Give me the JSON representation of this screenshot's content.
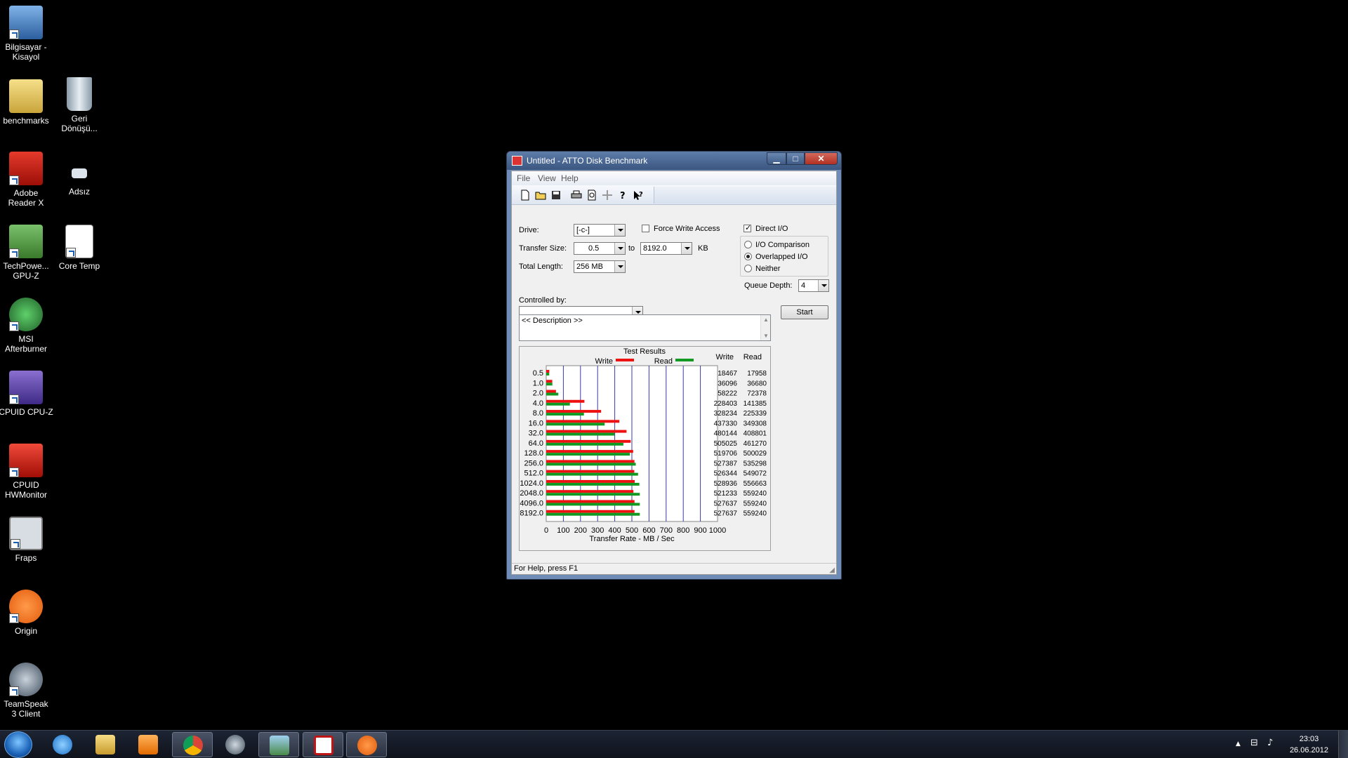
{
  "desktop": {
    "icons": [
      {
        "label": "Bilgisayar - Kisayol"
      },
      {
        "label": "benchmarks"
      },
      {
        "label": "Geri Dönüşü..."
      },
      {
        "label": "Adobe Reader X"
      },
      {
        "label": "Adsız"
      },
      {
        "label": "TechPowe... GPU-Z"
      },
      {
        "label": "Core Temp"
      },
      {
        "label": "MSI Afterburner"
      },
      {
        "label": "CPUID CPU-Z"
      },
      {
        "label": "CPUID HWMonitor"
      },
      {
        "label": "Fraps"
      },
      {
        "label": "Origin"
      },
      {
        "label": "TeamSpeak 3 Client"
      }
    ]
  },
  "window": {
    "title": "Untitled - ATTO Disk Benchmark",
    "minimize": "▁",
    "maximize": "□",
    "close": "✕",
    "menu": [
      "File",
      "View",
      "Help"
    ],
    "toolbar_icons": [
      "new-icon",
      "open-icon",
      "save-icon",
      "print-icon",
      "print-preview-icon",
      "move-icon",
      "help-icon",
      "context-help-icon"
    ],
    "drive_label": "Drive:",
    "drive_value": "[-c-]",
    "transfer_size_label": "Transfer Size:",
    "transfer_from": "0.5",
    "transfer_to_label": "to",
    "transfer_to": "8192.0",
    "transfer_unit": "KB",
    "total_length_label": "Total Length:",
    "total_length_value": "256 MB",
    "force_write_label": "Force Write Access",
    "force_write_checked": false,
    "direct_io_label": "Direct I/O",
    "direct_io_checked": true,
    "io_options": [
      {
        "label": "I/O Comparison",
        "selected": false
      },
      {
        "label": "Overlapped I/O",
        "selected": true
      },
      {
        "label": "Neither",
        "selected": false
      }
    ],
    "queue_depth_label": "Queue Depth:",
    "queue_depth_value": "4",
    "controlled_by_label": "Controlled by:",
    "controlled_by_value": "",
    "start_label": "Start",
    "description_text": "<< Description >>",
    "status_text": "For Help, press F1"
  },
  "results": {
    "heading": "Test Results",
    "legend_write": "Write",
    "legend_read": "Read",
    "col_write": "Write",
    "col_read": "Read",
    "write_color": "#ee1111",
    "read_color": "#119922"
  },
  "chart_data": {
    "type": "bar",
    "title": "Test Results",
    "xlabel": "Transfer Rate - MB / Sec",
    "xlim": [
      0,
      1000
    ],
    "xticks": [
      "0",
      "100",
      "200",
      "300",
      "400",
      "500",
      "600",
      "700",
      "800",
      "900",
      "1000"
    ],
    "categories": [
      "0.5",
      "1.0",
      "2.0",
      "4.0",
      "8.0",
      "16.0",
      "32.0",
      "64.0",
      "128.0",
      "256.0",
      "512.0",
      "1024.0",
      "2048.0",
      "4096.0",
      "8192.0"
    ],
    "series": [
      {
        "name": "Write",
        "values": [
          18467,
          36096,
          58222,
          228403,
          328234,
          437330,
          480144,
          505025,
          519706,
          527387,
          526344,
          528936,
          521233,
          527637,
          527637
        ]
      },
      {
        "name": "Read",
        "values": [
          17958,
          36680,
          72378,
          141385,
          225339,
          349308,
          408801,
          461270,
          500029,
          535298,
          549072,
          556663,
          559240,
          559240,
          559240
        ]
      }
    ]
  },
  "taskbar": {
    "apps": [
      "start-orb",
      "internet-explorer-icon",
      "explorer-icon",
      "media-player-icon",
      "chrome-icon",
      "teamspeak-icon",
      "network-icon",
      "atto-icon",
      "origin-icon"
    ],
    "time": "23:03",
    "date": "26.06.2012"
  }
}
